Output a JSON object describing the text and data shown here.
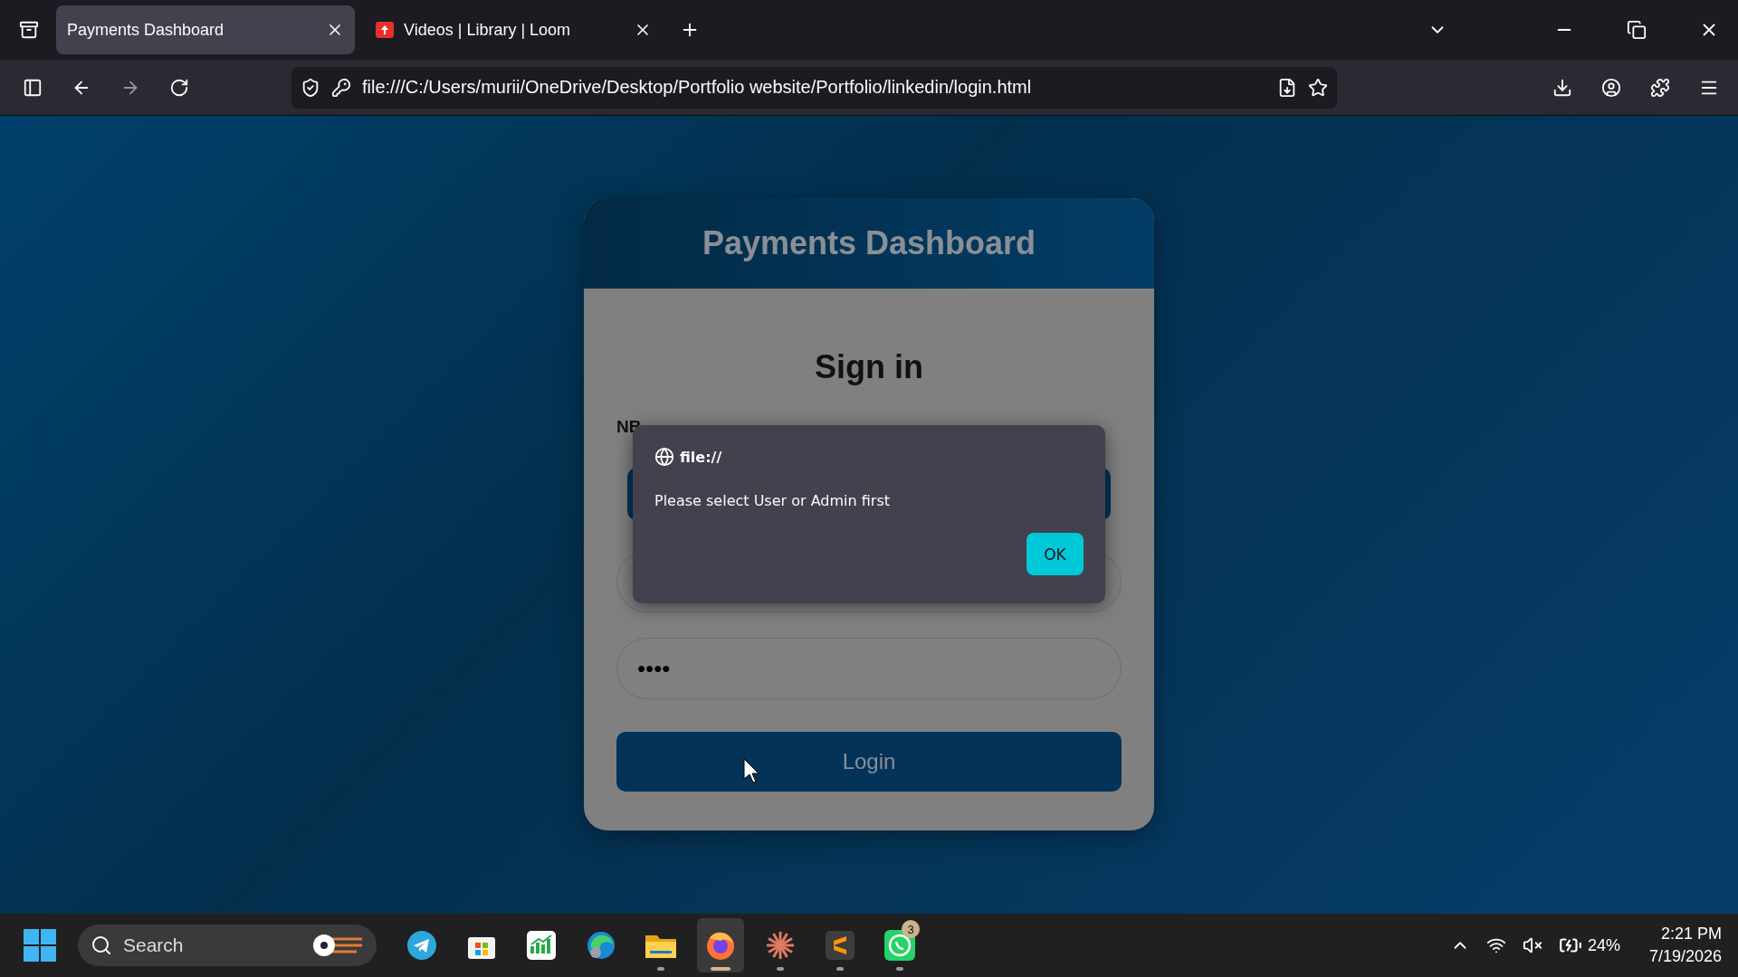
{
  "browser": {
    "tabs": [
      {
        "label": "Payments Dashboard",
        "selected": true,
        "kind": "page"
      },
      {
        "label": "Videos | Library | Loom",
        "selected": false,
        "kind": "video"
      }
    ],
    "address": "file:///C:/Users/murii/OneDrive/Desktop/Portfolio website/Portfolio/linkedin/login.html"
  },
  "page": {
    "header": "Payments Dashboard",
    "title": "Sign in",
    "note": "NB",
    "password": "••••",
    "login_button": "Login"
  },
  "dialog": {
    "origin": "file://",
    "message": "Please select User or Admin first",
    "ok_button": "OK"
  },
  "taskbar": {
    "search": "Search",
    "apps": [
      {
        "kind": "telegram",
        "running": false,
        "active": false
      },
      {
        "kind": "store",
        "running": false,
        "active": false
      },
      {
        "kind": "chart",
        "running": false,
        "active": false
      },
      {
        "kind": "edge",
        "running": false,
        "active": false
      },
      {
        "kind": "files",
        "running": true,
        "active": false
      },
      {
        "kind": "firefox",
        "running": true,
        "active": true
      },
      {
        "kind": "spark",
        "running": true,
        "active": false
      },
      {
        "kind": "sublime",
        "running": true,
        "active": false
      },
      {
        "kind": "whatsapp",
        "running": true,
        "active": false,
        "badge": "3"
      }
    ],
    "battery": "24%",
    "time": "2:21 PM",
    "date": "7/19/2026"
  }
}
